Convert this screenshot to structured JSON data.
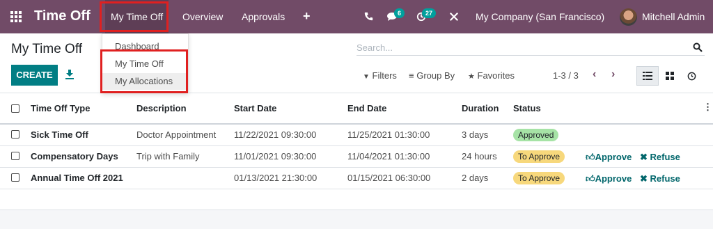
{
  "app": {
    "title": "Time Off"
  },
  "nav": {
    "my_time_off": "My Time Off",
    "overview": "Overview",
    "approvals": "Approvals",
    "plus": "+"
  },
  "systray": {
    "messages_count": "6",
    "activity_count": "27",
    "company": "My Company (San Francisco)",
    "user": "Mitchell Admin"
  },
  "dropdown": {
    "items": [
      "Dashboard",
      "My Time Off",
      "My Allocations"
    ]
  },
  "control": {
    "breadcrumb": "My Time Off",
    "create_label": "CREATE",
    "search_placeholder": "Search...",
    "filters_label": "Filters",
    "groupby_label": "Group By",
    "favorites_label": "Favorites",
    "pager": "1-3 / 3"
  },
  "table": {
    "columns": [
      "Time Off Type",
      "Description",
      "Start Date",
      "End Date",
      "Duration",
      "Status"
    ],
    "rows": [
      {
        "type": "Sick Time Off",
        "description": "Doctor Appointment",
        "start": "11/22/2021 09:30:00",
        "end": "11/25/2021 01:30:00",
        "duration": "3 days",
        "status": "Approved",
        "approve": "",
        "refuse": ""
      },
      {
        "type": "Compensatory Days",
        "description": "Trip with Family",
        "start": "11/01/2021 09:30:00",
        "end": "11/04/2021 01:30:00",
        "duration": "24 hours",
        "status": "To Approve",
        "approve": "Approve",
        "refuse": "Refuse"
      },
      {
        "type": "Annual Time Off 2021",
        "description": "",
        "start": "01/13/2021 21:30:00",
        "end": "01/15/2021 06:30:00",
        "duration": "2 days",
        "status": "To Approve",
        "approve": "Approve",
        "refuse": "Refuse"
      }
    ]
  },
  "colors": {
    "brand": "#714b67",
    "primary_button": "#017e84",
    "approved": "#a6e3a6",
    "to_approve": "#f7d87c",
    "highlight_box": "#e02020"
  }
}
